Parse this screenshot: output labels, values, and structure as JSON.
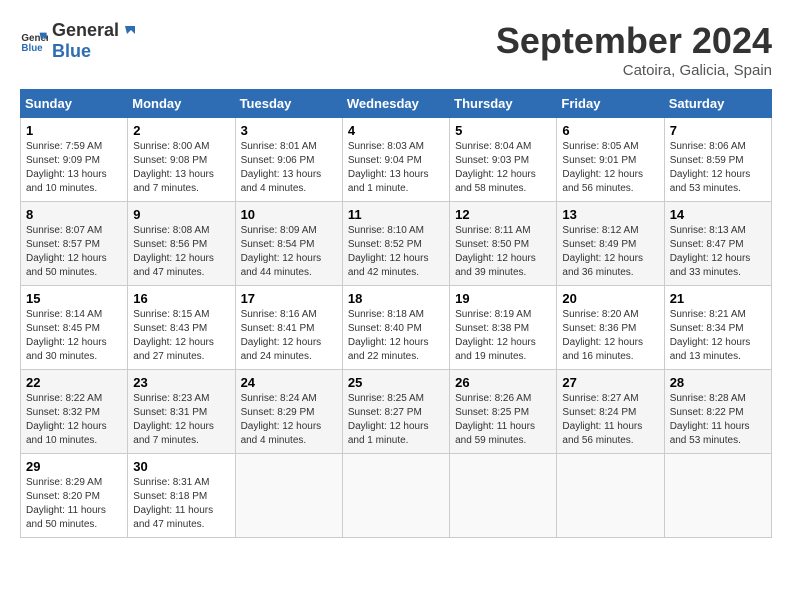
{
  "header": {
    "logo_general": "General",
    "logo_blue": "Blue",
    "month_title": "September 2024",
    "subtitle": "Catoira, Galicia, Spain"
  },
  "days_of_week": [
    "Sunday",
    "Monday",
    "Tuesday",
    "Wednesday",
    "Thursday",
    "Friday",
    "Saturday"
  ],
  "weeks": [
    [
      {
        "day": "1",
        "sunrise": "7:59 AM",
        "sunset": "9:09 PM",
        "daylight": "13 hours and 10 minutes."
      },
      {
        "day": "2",
        "sunrise": "8:00 AM",
        "sunset": "9:08 PM",
        "daylight": "13 hours and 7 minutes."
      },
      {
        "day": "3",
        "sunrise": "8:01 AM",
        "sunset": "9:06 PM",
        "daylight": "13 hours and 4 minutes."
      },
      {
        "day": "4",
        "sunrise": "8:03 AM",
        "sunset": "9:04 PM",
        "daylight": "13 hours and 1 minute."
      },
      {
        "day": "5",
        "sunrise": "8:04 AM",
        "sunset": "9:03 PM",
        "daylight": "12 hours and 58 minutes."
      },
      {
        "day": "6",
        "sunrise": "8:05 AM",
        "sunset": "9:01 PM",
        "daylight": "12 hours and 56 minutes."
      },
      {
        "day": "7",
        "sunrise": "8:06 AM",
        "sunset": "8:59 PM",
        "daylight": "12 hours and 53 minutes."
      }
    ],
    [
      {
        "day": "8",
        "sunrise": "8:07 AM",
        "sunset": "8:57 PM",
        "daylight": "12 hours and 50 minutes."
      },
      {
        "day": "9",
        "sunrise": "8:08 AM",
        "sunset": "8:56 PM",
        "daylight": "12 hours and 47 minutes."
      },
      {
        "day": "10",
        "sunrise": "8:09 AM",
        "sunset": "8:54 PM",
        "daylight": "12 hours and 44 minutes."
      },
      {
        "day": "11",
        "sunrise": "8:10 AM",
        "sunset": "8:52 PM",
        "daylight": "12 hours and 42 minutes."
      },
      {
        "day": "12",
        "sunrise": "8:11 AM",
        "sunset": "8:50 PM",
        "daylight": "12 hours and 39 minutes."
      },
      {
        "day": "13",
        "sunrise": "8:12 AM",
        "sunset": "8:49 PM",
        "daylight": "12 hours and 36 minutes."
      },
      {
        "day": "14",
        "sunrise": "8:13 AM",
        "sunset": "8:47 PM",
        "daylight": "12 hours and 33 minutes."
      }
    ],
    [
      {
        "day": "15",
        "sunrise": "8:14 AM",
        "sunset": "8:45 PM",
        "daylight": "12 hours and 30 minutes."
      },
      {
        "day": "16",
        "sunrise": "8:15 AM",
        "sunset": "8:43 PM",
        "daylight": "12 hours and 27 minutes."
      },
      {
        "day": "17",
        "sunrise": "8:16 AM",
        "sunset": "8:41 PM",
        "daylight": "12 hours and 24 minutes."
      },
      {
        "day": "18",
        "sunrise": "8:18 AM",
        "sunset": "8:40 PM",
        "daylight": "12 hours and 22 minutes."
      },
      {
        "day": "19",
        "sunrise": "8:19 AM",
        "sunset": "8:38 PM",
        "daylight": "12 hours and 19 minutes."
      },
      {
        "day": "20",
        "sunrise": "8:20 AM",
        "sunset": "8:36 PM",
        "daylight": "12 hours and 16 minutes."
      },
      {
        "day": "21",
        "sunrise": "8:21 AM",
        "sunset": "8:34 PM",
        "daylight": "12 hours and 13 minutes."
      }
    ],
    [
      {
        "day": "22",
        "sunrise": "8:22 AM",
        "sunset": "8:32 PM",
        "daylight": "12 hours and 10 minutes."
      },
      {
        "day": "23",
        "sunrise": "8:23 AM",
        "sunset": "8:31 PM",
        "daylight": "12 hours and 7 minutes."
      },
      {
        "day": "24",
        "sunrise": "8:24 AM",
        "sunset": "8:29 PM",
        "daylight": "12 hours and 4 minutes."
      },
      {
        "day": "25",
        "sunrise": "8:25 AM",
        "sunset": "8:27 PM",
        "daylight": "12 hours and 1 minute."
      },
      {
        "day": "26",
        "sunrise": "8:26 AM",
        "sunset": "8:25 PM",
        "daylight": "11 hours and 59 minutes."
      },
      {
        "day": "27",
        "sunrise": "8:27 AM",
        "sunset": "8:24 PM",
        "daylight": "11 hours and 56 minutes."
      },
      {
        "day": "28",
        "sunrise": "8:28 AM",
        "sunset": "8:22 PM",
        "daylight": "11 hours and 53 minutes."
      }
    ],
    [
      {
        "day": "29",
        "sunrise": "8:29 AM",
        "sunset": "8:20 PM",
        "daylight": "11 hours and 50 minutes."
      },
      {
        "day": "30",
        "sunrise": "8:31 AM",
        "sunset": "8:18 PM",
        "daylight": "11 hours and 47 minutes."
      },
      null,
      null,
      null,
      null,
      null
    ]
  ],
  "labels": {
    "sunrise": "Sunrise:",
    "sunset": "Sunset:",
    "daylight": "Daylight:"
  }
}
